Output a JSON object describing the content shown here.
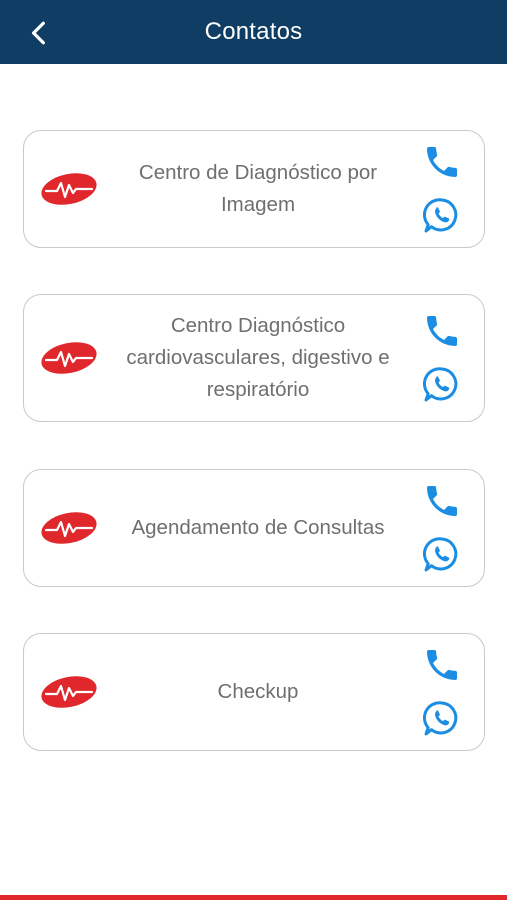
{
  "header": {
    "title": "Contatos",
    "back_icon": "chevron-left-icon"
  },
  "colors": {
    "header_bg": "#0f3d63",
    "accent_blue": "#1b8ee3",
    "logo_red": "#e0272b",
    "bottom_bar": "#e0272b"
  },
  "contacts": [
    {
      "label": "Centro de Diagnóstico por Imagem",
      "phone_icon": "phone-icon",
      "whatsapp_icon": "whatsapp-icon"
    },
    {
      "label": "Centro Diagnóstico cardiovasculares, digestivo e respiratório",
      "phone_icon": "phone-icon",
      "whatsapp_icon": "whatsapp-icon"
    },
    {
      "label": "Agendamento de Consultas",
      "phone_icon": "phone-icon",
      "whatsapp_icon": "whatsapp-icon"
    },
    {
      "label": "Checkup",
      "phone_icon": "phone-icon",
      "whatsapp_icon": "whatsapp-icon"
    }
  ]
}
